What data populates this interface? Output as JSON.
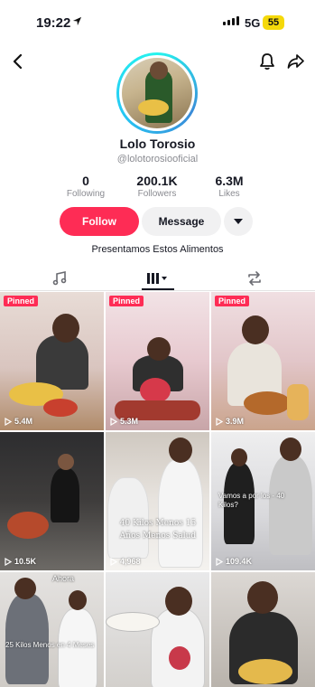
{
  "status": {
    "time": "19:22",
    "network": "5G",
    "battery": "55"
  },
  "profile": {
    "name": "Lolo Torosio",
    "handle": "@lolotorosiooficial",
    "stats": [
      {
        "value": "0",
        "label": "Following"
      },
      {
        "value": "200.1K",
        "label": "Followers"
      },
      {
        "value": "6.3M",
        "label": "Likes"
      }
    ],
    "follow_label": "Follow",
    "message_label": "Message",
    "bio": "Presentamos Estos Alimentos"
  },
  "videos": [
    {
      "pinned": "Pinned",
      "views": "5.4M"
    },
    {
      "pinned": "Pinned",
      "views": "5.3M"
    },
    {
      "pinned": "Pinned",
      "views": "3.9M"
    },
    {
      "views": "10.5K"
    },
    {
      "views": "4,968",
      "overlay": "40 Kilos Menos 15 Años Menos Salud"
    },
    {
      "views": "109.4K",
      "overlay": "Vamos a por los - 40 Kilos?"
    },
    {
      "overlay": "25 Kilos Menos en 4 Meses",
      "badge": "Ahora"
    },
    {},
    {}
  ],
  "colors": {
    "accent": "#fe2c55",
    "text": "#161823",
    "muted": "#8a8b91"
  }
}
